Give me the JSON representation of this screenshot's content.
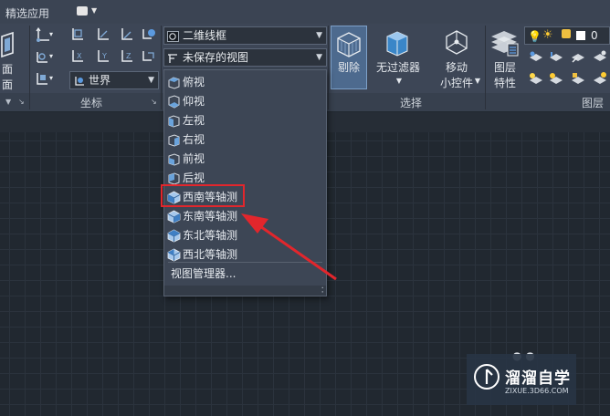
{
  "tabstrip": {
    "workspace_label": "精选应用"
  },
  "ribbon": {
    "view_panel": {
      "label_line1": "面",
      "label_line2": "面"
    },
    "coordinates_panel": {
      "title": "坐标",
      "ucs_combo_value": "世界"
    },
    "views_panel": {
      "visual_style_value": "二维线框",
      "saved_view_value": "未保存的视图"
    },
    "selection_panel": {
      "title": "选择",
      "cull_label": "剔除",
      "filter_label": "无过滤器",
      "gizmo_label_line1": "移动",
      "gizmo_label_line2": "小控件"
    },
    "layers_panel": {
      "title": "图层",
      "properties_line1": "图层",
      "properties_line2": "特性",
      "layer_value": "0"
    }
  },
  "view_dropdown": {
    "items": [
      {
        "label": "俯视",
        "icon": "top-view-icon"
      },
      {
        "label": "仰视",
        "icon": "bottom-view-icon"
      },
      {
        "label": "左视",
        "icon": "left-view-icon"
      },
      {
        "label": "右视",
        "icon": "right-view-icon"
      },
      {
        "label": "前视",
        "icon": "front-view-icon"
      },
      {
        "label": "后视",
        "icon": "back-view-icon"
      },
      {
        "label": "西南等轴测",
        "icon": "sw-isometric-icon"
      },
      {
        "label": "东南等轴测",
        "icon": "se-isometric-icon"
      },
      {
        "label": "东北等轴测",
        "icon": "ne-isometric-icon"
      },
      {
        "label": "西北等轴测",
        "icon": "nw-isometric-icon"
      }
    ],
    "manager_label": "视图管理器..."
  },
  "annotation": {
    "highlight_color": "#e2262c",
    "arrow_color": "#e2262c"
  },
  "watermark": {
    "title": "溜溜自学",
    "subtitle": "ZIXUE.3D66.COM"
  },
  "colors": {
    "ribbon": "#3d4656",
    "canvas": "#212830",
    "active": "#4d6a8e"
  }
}
